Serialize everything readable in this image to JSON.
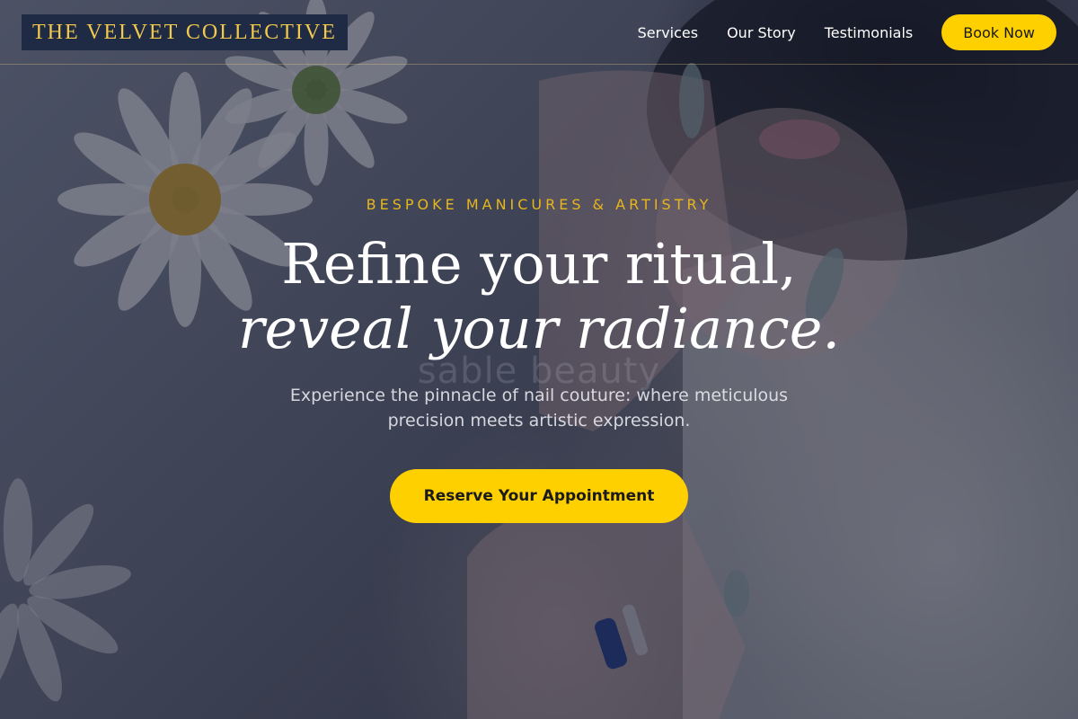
{
  "brand": {
    "name": "THE VELVET COLLECTIVE"
  },
  "nav": {
    "items": [
      {
        "label": "Services"
      },
      {
        "label": "Our Story"
      },
      {
        "label": "Testimonials"
      }
    ],
    "book_label": "Book Now"
  },
  "hero": {
    "eyebrow": "BESPOKE MANICURES & ARTISTRY",
    "headline_line1": "Refine your ritual,",
    "headline_line2": "reveal your radiance.",
    "background_text": "sable beauty",
    "subtitle": "Experience the pinnacle of nail couture: where meticulous precision meets artistic expression.",
    "cta_label": "Reserve Your Appointment"
  },
  "colors": {
    "accent": "#ffd000",
    "eyebrow": "#e7b61c",
    "logo_bg": "#1f2b44",
    "overlay": "#191e30"
  },
  "icons": {
    "hero_image": "woman-hands-daisies-photo"
  }
}
